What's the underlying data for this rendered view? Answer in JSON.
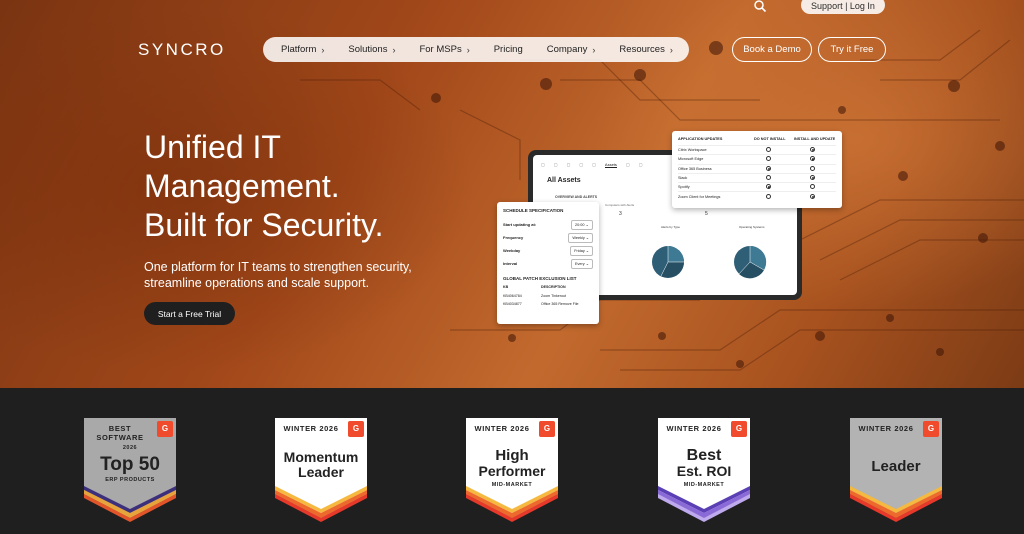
{
  "brand": {
    "logo": "SYNCRO"
  },
  "utility": {
    "search_icon": "search-icon",
    "login_label": "Support | Log In"
  },
  "nav": {
    "items": [
      {
        "label": "Platform",
        "chevron": "›"
      },
      {
        "label": "Solutions",
        "chevron": "›"
      },
      {
        "label": "For MSPs",
        "chevron": "›"
      },
      {
        "label": "Pricing",
        "chevron": ""
      },
      {
        "label": "Company",
        "chevron": "›"
      },
      {
        "label": "Resources",
        "chevron": "›"
      }
    ],
    "book_demo": "Book a Demo",
    "try_free": "Try it Free"
  },
  "hero": {
    "headline": [
      "Unified IT",
      "Management.",
      "Built for Security."
    ],
    "subhead": [
      "One platform for IT teams to strengthen security,",
      "streamline operations and scale support."
    ],
    "cta": "Start a Free Trial"
  },
  "mockup": {
    "tabs": [
      "▢",
      "▢",
      "▢",
      "▢",
      "▢",
      "Assets",
      "▢",
      "▢"
    ],
    "title": "All Assets",
    "section": "OVERVIEW AND ALERTS",
    "note": "Computers with Alerts",
    "num1": "3",
    "num2": "5",
    "chart1_title": "Alerts by Type",
    "chart2_title": "Operating Systems",
    "app_updates": {
      "headers": [
        "APPLICATION UPDATES",
        "DO NOT INSTALL",
        "INSTALL AND UPDATE"
      ],
      "rows": [
        {
          "name": "Citrix Workspace",
          "do_not": false,
          "install": true
        },
        {
          "name": "Microsoft Edge",
          "do_not": false,
          "install": true
        },
        {
          "name": "Office 365 Business",
          "do_not": true,
          "install": false
        },
        {
          "name": "Slack",
          "do_not": false,
          "install": true
        },
        {
          "name": "Spotify",
          "do_not": true,
          "install": false
        },
        {
          "name": "Zoom Client for Meetings",
          "do_not": false,
          "install": true
        }
      ]
    },
    "schedule": {
      "title": "SCHEDULE SPECIFICATION",
      "rows": [
        {
          "label": "Start updating at:",
          "value": "20:00 ⌄"
        },
        {
          "label": "Frequency",
          "value": "Weekly ⌄"
        },
        {
          "label": "Weekday",
          "value": "Friday ⌄"
        },
        {
          "label": "Interval",
          "value": "Every ⌄"
        }
      ],
      "exclusion_title": "GLOBAL PATCH EXCLUSION LIST",
      "table_headers": [
        "KB",
        "DESCRIPTION"
      ],
      "table_rows": [
        [
          "KB4064784",
          "Zoom Tinkerout"
        ],
        [
          "KB4034877",
          "Office 365 Remove File"
        ]
      ]
    }
  },
  "badges": [
    {
      "top": "BEST SOFTWARE",
      "g2": "G",
      "year": "2026",
      "main": [
        "Top 50"
      ],
      "small": "ERP PRODUCTS",
      "bg": "#a9a9a9",
      "stripes": [
        "#3c2f7c",
        "#e8a43c",
        "#e2552b"
      ]
    },
    {
      "top": "WINTER 2026",
      "g2": "G",
      "main": [
        "Momentum",
        "Leader"
      ],
      "small": "",
      "bg": "#ffffff",
      "stripes": [
        "#f5b93f",
        "#ee6a2c",
        "#e6392a"
      ]
    },
    {
      "top": "WINTER 2026",
      "g2": "G",
      "main": [
        "High",
        "Performer"
      ],
      "small": "MID-MARKET",
      "bg": "#ffffff",
      "stripes": [
        "#f5b93f",
        "#ee6a2c",
        "#e6392a"
      ]
    },
    {
      "top": "WINTER 2026",
      "g2": "G",
      "main": [
        "Best",
        "Est. ROI"
      ],
      "small": "MID-MARKET",
      "bg": "#ffffff",
      "stripes": [
        "#5b3fb5",
        "#8a6ad6",
        "#bfa9ef"
      ]
    },
    {
      "top": "WINTER 2026",
      "g2": "G",
      "main": [
        "Leader"
      ],
      "small": "",
      "bg": "#b3b3b3",
      "stripes": [
        "#f5b93f",
        "#ee6a2c",
        "#e6392a"
      ]
    }
  ]
}
